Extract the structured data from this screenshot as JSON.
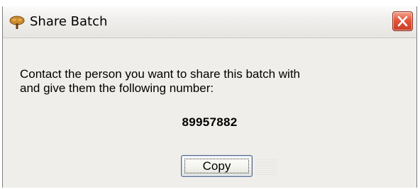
{
  "window": {
    "title": "Share Batch",
    "title_icon": "tree-icon",
    "close_icon": "close-icon"
  },
  "dialog": {
    "message_line1": "Contact the person you want to share this batch with",
    "message_line2": "and give them the following number:",
    "share_number": "89957882"
  },
  "buttons": {
    "copy_label": "Copy"
  },
  "colors": {
    "window_background": "#efeeeb",
    "close_button": "#e2553b",
    "tree_icon_leaves": "#c98a2e",
    "tree_icon_trunk": "#6b3a12"
  }
}
